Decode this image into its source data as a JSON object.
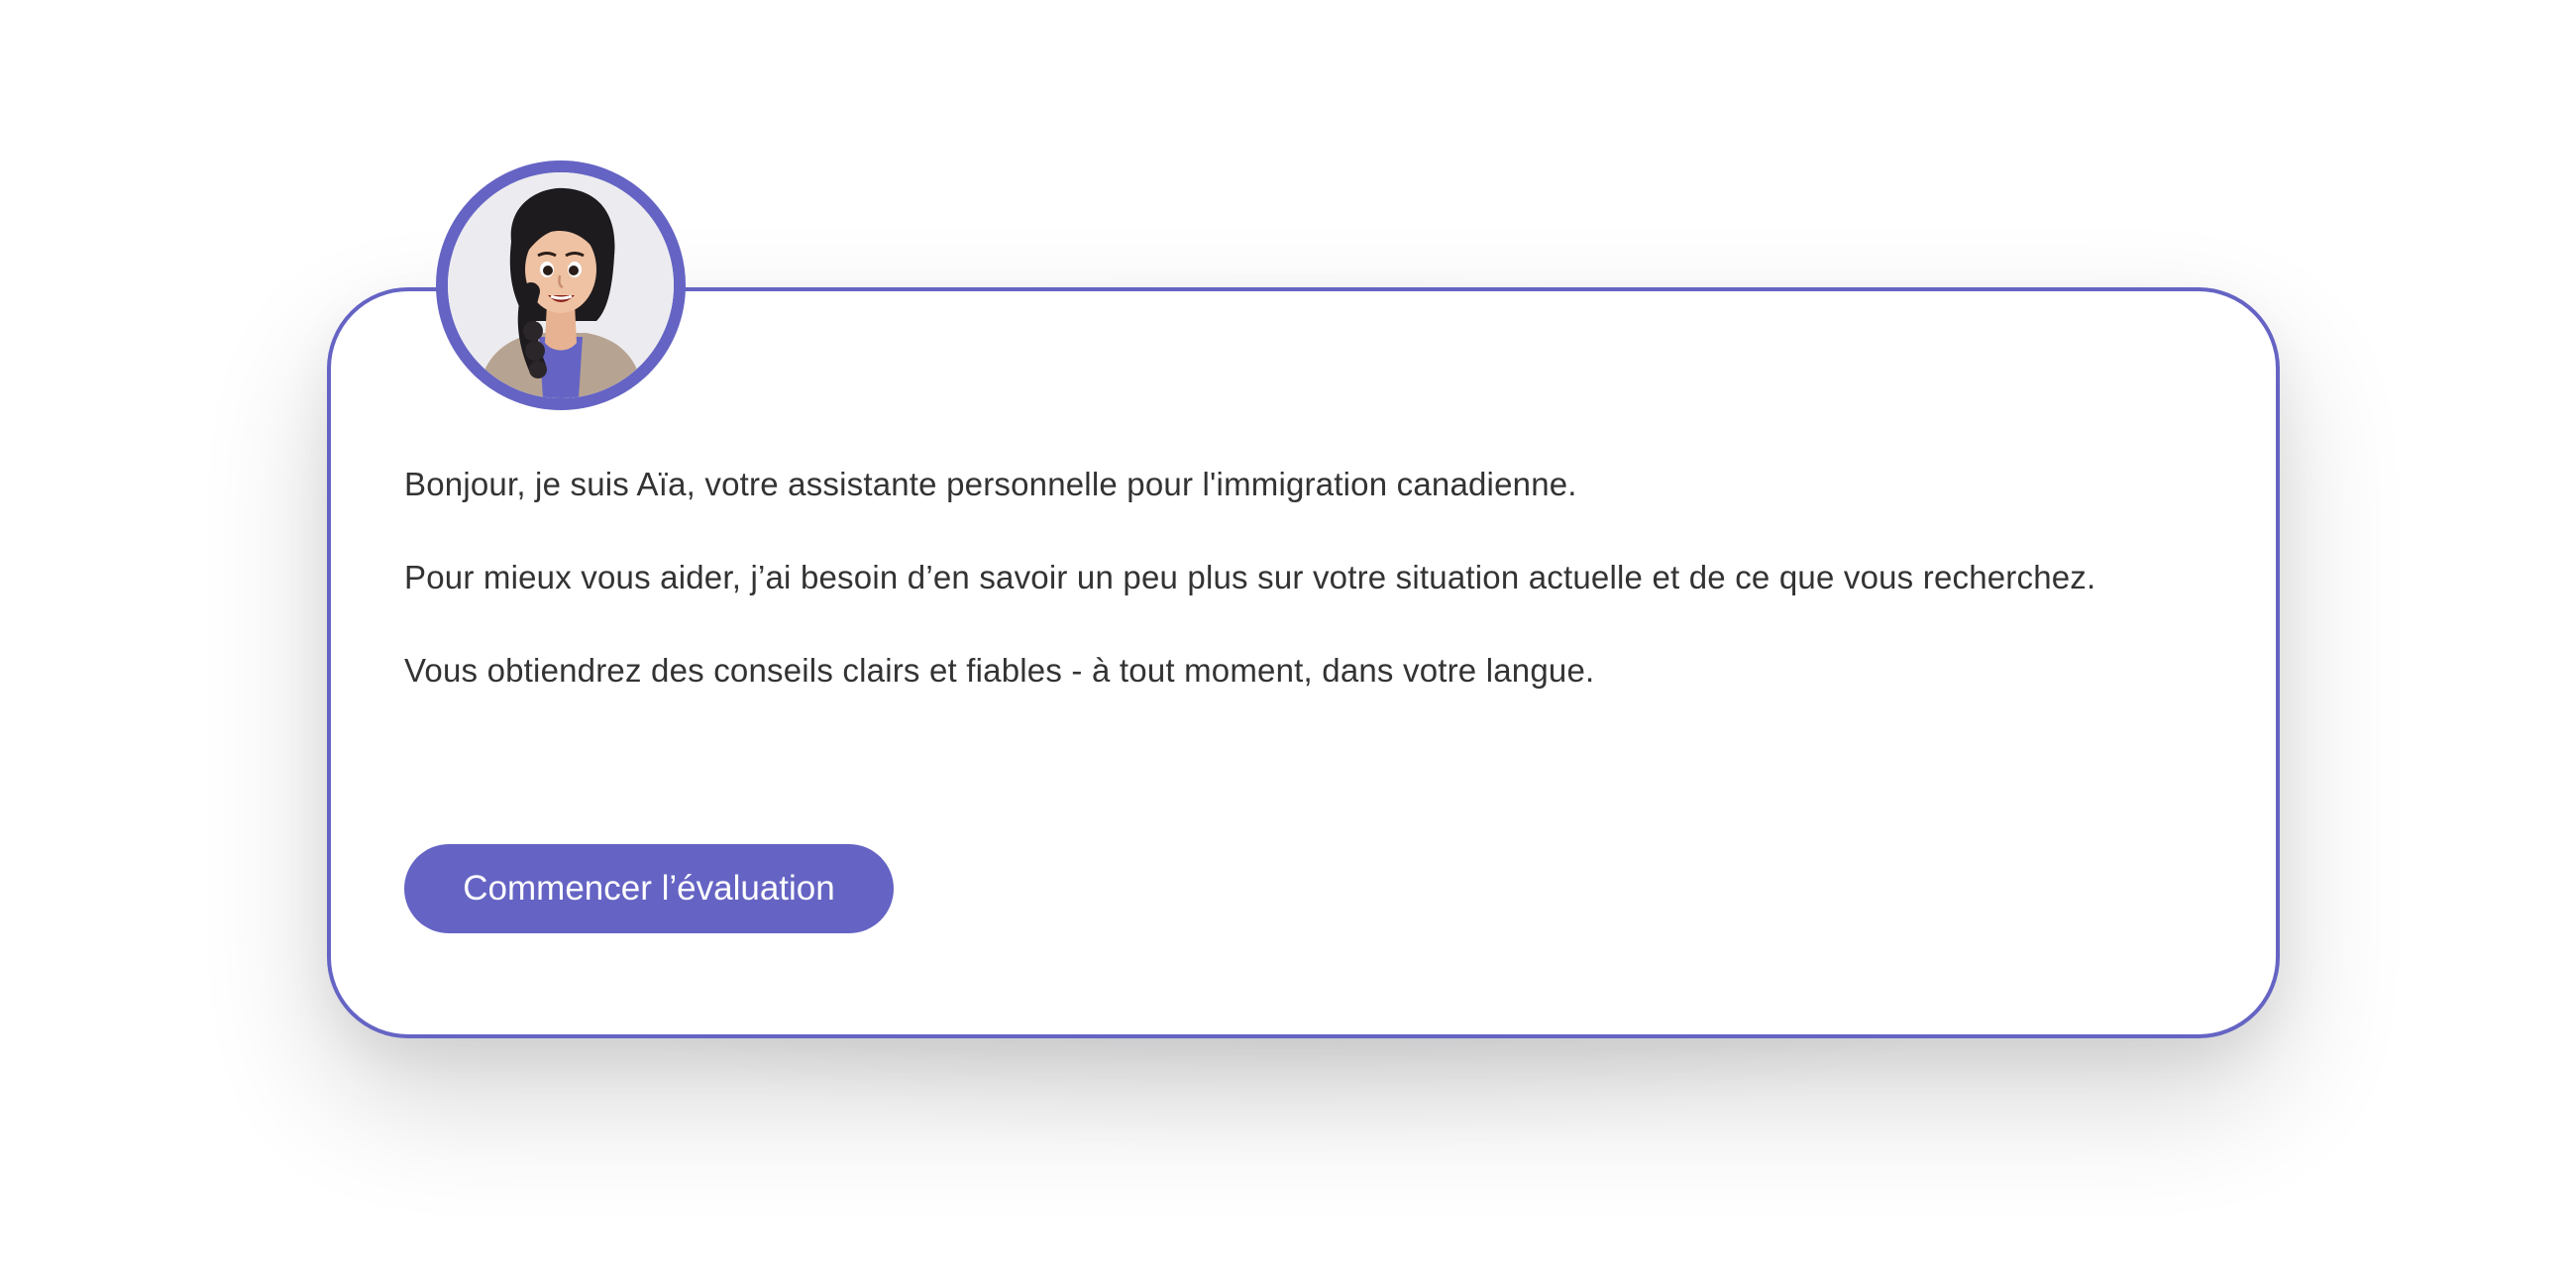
{
  "assistant": {
    "name": "Aïa",
    "avatar_icon": "female-assistant-avatar-icon"
  },
  "messages": [
    "Bonjour, je suis Aïa, votre assistante personnelle pour l'immigration canadienne.",
    "Pour mieux vous aider, j’ai besoin d’en savoir un peu plus sur votre situation actuelle et de ce que vous recherchez.",
    "Vous obtiendrez des conseils clairs et fiables - à tout moment, dans votre langue."
  ],
  "cta": {
    "label": "Commencer l’évaluation"
  },
  "colors": {
    "accent": "#6564c4",
    "text": "#333333",
    "card_background": "#ffffff"
  }
}
